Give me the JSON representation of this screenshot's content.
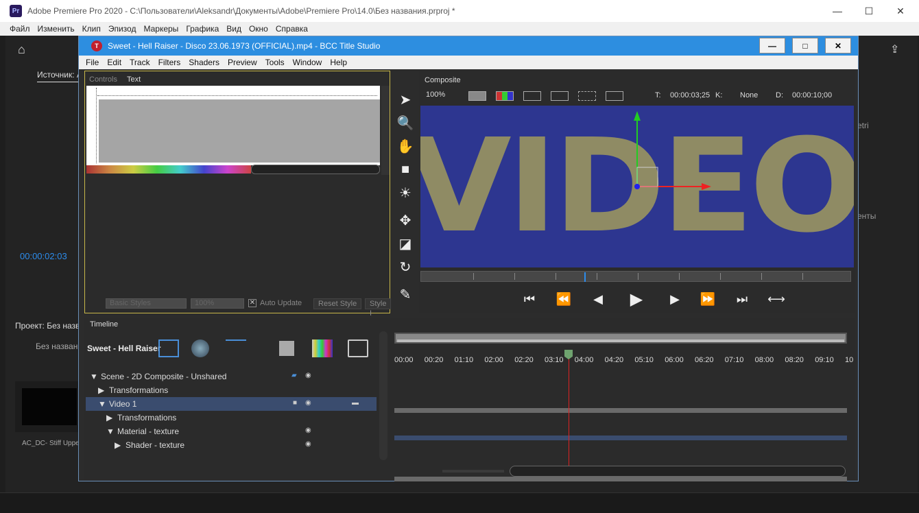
{
  "premiere": {
    "title": "Adobe Premiere Pro 2020 - C:\\Пользователи\\Aleksandr\\Документы\\Adobe\\Premiere Pro\\14.0\\Без названия.prproj *",
    "logo": "Pr",
    "menu": [
      "Файл",
      "Изменить",
      "Клип",
      "Эпизод",
      "Маркеры",
      "Графика",
      "Вид",
      "Окно",
      "Справка"
    ],
    "source_tab": "Источник: A",
    "timecode": "00:00:02:03",
    "project_tab": "Проект: Без назва",
    "project_name": "Без названи",
    "thumb_label": "AC_DC- Stiff Upper...",
    "right_text1": "etri",
    "right_text2": "енты"
  },
  "bcc": {
    "icon": "T",
    "title": "Sweet - Hell Raiser - Disco 23.06.1973 (OFFICIAL).mp4 - BCC Title Studio",
    "menu": [
      "File",
      "Edit",
      "Track",
      "Filters",
      "Shaders",
      "Preview",
      "Tools",
      "Window",
      "Help"
    ],
    "controls": {
      "tab_controls": "Controls",
      "tab_text": "Text",
      "basic_styles": "Basic Styles",
      "percent": "100%",
      "auto_update": "Auto Update",
      "reset_style": "Reset Style",
      "style_btn": "Style I"
    },
    "composite": {
      "tab": "Composite",
      "zoom": "100%",
      "t_label": "T:",
      "t_value": "00:00:03;25",
      "k_label": "K:",
      "k_value": "None",
      "d_label": "D:",
      "d_value": "00:00:10;00",
      "viewer_text": "VIDEO"
    },
    "timeline": {
      "tab": "Timeline",
      "clip_name": "Sweet - Hell Raiser",
      "tracks": [
        {
          "label": "Scene - 2D Composite - Unshared",
          "indent": 0,
          "arrow": "▼"
        },
        {
          "label": "Transformations",
          "indent": 1,
          "arrow": "▶"
        },
        {
          "label": "Video 1",
          "indent": 1,
          "arrow": "▼"
        },
        {
          "label": "Transformations",
          "indent": 2,
          "arrow": "▶"
        },
        {
          "label": "Material - texture",
          "indent": 2,
          "arrow": "▼"
        },
        {
          "label": "Shader - texture",
          "indent": 3,
          "arrow": "▶"
        }
      ],
      "time_labels": [
        "00:00",
        "00:20",
        "01:10",
        "02:00",
        "02:20",
        "03:10",
        "04:00",
        "04:20",
        "05:10",
        "06:00",
        "06:20",
        "07:10",
        "08:00",
        "08:20",
        "09:10",
        "10"
      ]
    }
  }
}
